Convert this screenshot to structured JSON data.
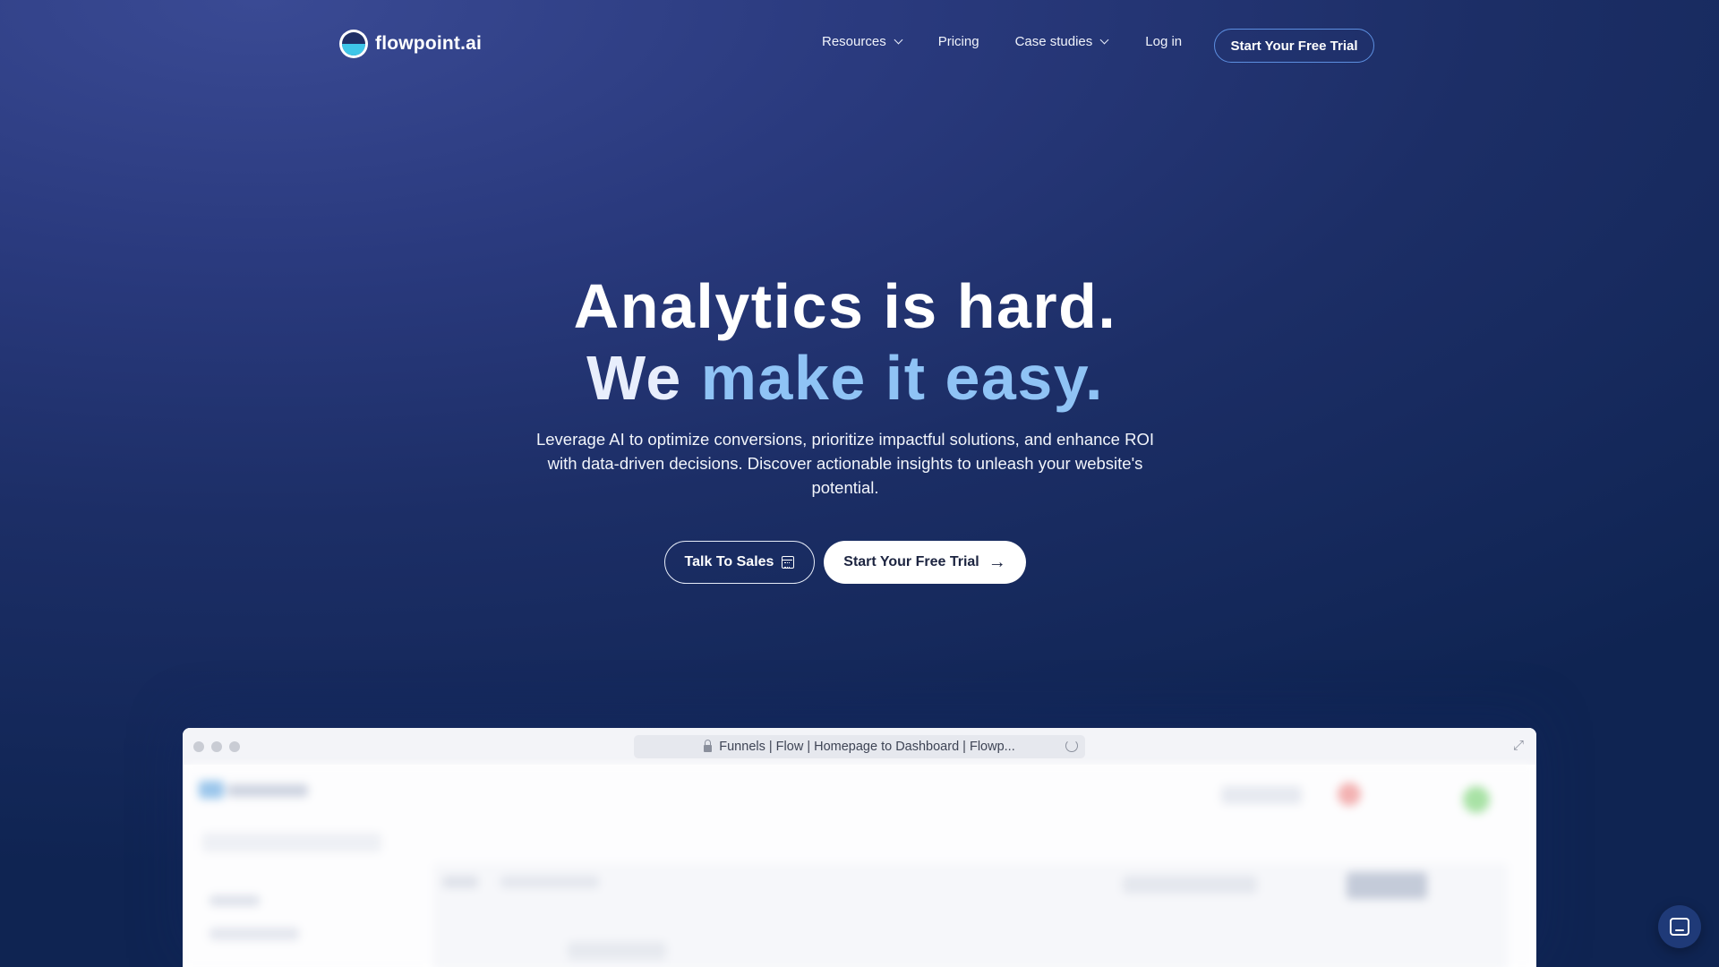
{
  "nav": {
    "logo_text": "flowpoint.ai",
    "items": [
      {
        "label": "Resources",
        "dropdown": true
      },
      {
        "label": "Pricing",
        "dropdown": false
      },
      {
        "label": "Case studies",
        "dropdown": true
      },
      {
        "label": "Log in",
        "dropdown": false
      }
    ],
    "cta_label": "Start Your Free Trial"
  },
  "hero": {
    "headline_line1": "Analytics is hard.",
    "headline_line2_prefix": "We",
    "headline_line2_highlight": "make it easy.",
    "subtitle": "Leverage AI to optimize conversions, prioritize impactful solutions, and enhance ROI with data-driven decisions. Discover actionable insights to unleash your website's potential.",
    "talk_button_label": "Talk To Sales",
    "trial_button_label": "Start Your Free Trial"
  },
  "browser": {
    "url_title": "Funnels | Flow | Homepage to Dashboard | Flowp..."
  },
  "colors": {
    "background_top": "#3a4a94",
    "background_bottom": "#0f2452",
    "headline_highlight": "#8fc3f5",
    "nav_cta_border": "#5d8fe0"
  },
  "icons": [
    "logo-icon",
    "chevron-down-icon",
    "calendar-icon",
    "arrow-right-icon",
    "lock-icon",
    "reload-icon",
    "expand-icon",
    "chat-icon"
  ]
}
